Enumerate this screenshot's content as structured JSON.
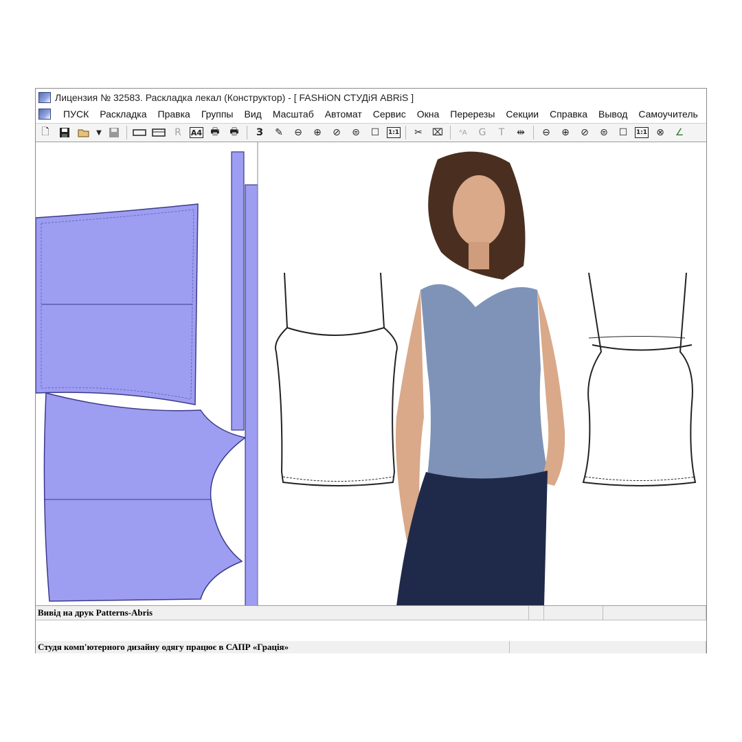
{
  "window": {
    "title": "Лицензия № 32583. Раскладка лекал (Конструктор) - [  FASHiON СТУДiЯ ABRiS  ]"
  },
  "menu": {
    "items": [
      "ПУСК",
      "Раскладка",
      "Правка",
      "Группы",
      "Вид",
      "Масштаб",
      "Автомат",
      "Сервис",
      "Окна",
      "Перерезы",
      "Секции",
      "Справка",
      "Вывод",
      "Самоучитель"
    ]
  },
  "toolbar": {
    "a4_label": "A4",
    "three_label": "З",
    "one_to_one_label": "1:1",
    "r_label": "R",
    "g_label": "G",
    "t_label": "T",
    "icons": [
      "new-file-icon",
      "save-icon",
      "open-folder-icon",
      "dropdown-arrow-icon",
      "disk-icon",
      "layout-icon",
      "layout-frame-icon",
      "r-icon",
      "a4-icon",
      "print-icon",
      "print-preview-icon",
      "three-icon",
      "pen-icon",
      "zoom-out-icon",
      "zoom-in-icon",
      "zoom-window-icon",
      "zoom-prev-icon",
      "fit-page-icon",
      "one-to-one-icon",
      "scissors-icon",
      "cut-piece-icon",
      "text-tool-icon",
      "g-icon",
      "t-icon",
      "width-icon",
      "zoom-out-icon",
      "zoom-in-icon",
      "zoom-window-icon",
      "zoom-prev-icon",
      "fit-page-icon",
      "one-to-one-icon",
      "cancel-zoom-icon",
      "angle-icon"
    ]
  },
  "colors": {
    "pattern_fill": "#9d9df1",
    "pattern_stroke": "#3a3a8a",
    "menu_bg": "#ffffff",
    "status_bg": "#f0f0f0"
  },
  "status": {
    "line1": "Вивід на друк Patterns-Abris",
    "line2": "Студя  комп'ютерного дизайну одягу працює в САПР «Грація»"
  }
}
